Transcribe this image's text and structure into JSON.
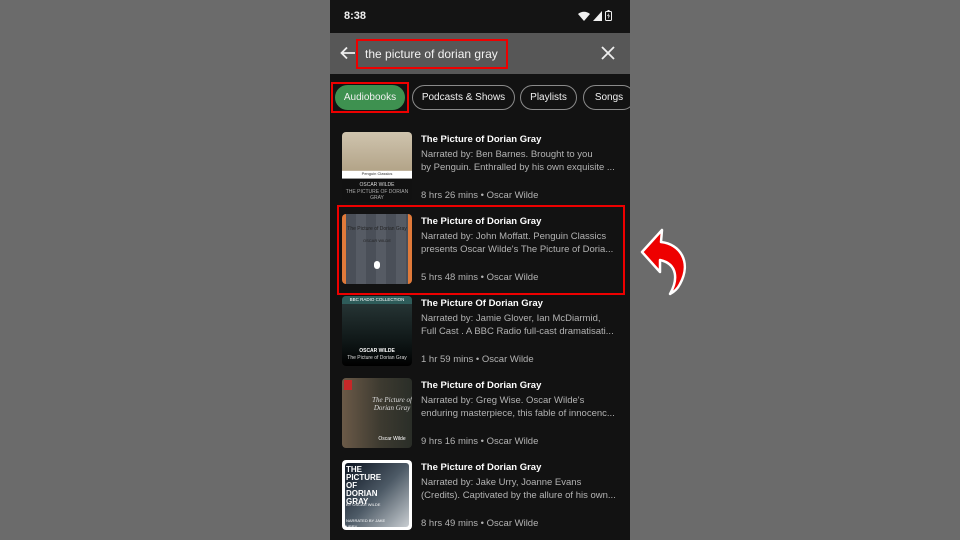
{
  "status_bar": {
    "time": "8:38",
    "icons": [
      "wifi-icon",
      "cell-signal-icon",
      "battery-charging-icon"
    ]
  },
  "search": {
    "back_icon": "arrow-left-icon",
    "query": "the picture of dorian gray",
    "clear_icon": "close-icon"
  },
  "filters": {
    "chips": [
      {
        "label": "Audiobooks",
        "active": true
      },
      {
        "label": "Podcasts & Shows",
        "active": false
      },
      {
        "label": "Playlists",
        "active": false
      },
      {
        "label": "Songs",
        "active": false
      }
    ]
  },
  "results": [
    {
      "title": "The Picture of Dorian Gray",
      "desc_line1": "Narrated by: Ben Barnes. Brought to you",
      "desc_line2": "by Penguin. Enthralled by his own exquisite ...",
      "duration": "8 hrs 26 mins",
      "author": "Oscar Wilde",
      "cover": {
        "top": "Penguin Classics",
        "author": "OSCAR WILDE",
        "title": "THE PICTURE OF DORIAN GRAY"
      }
    },
    {
      "title": "The Picture of Dorian Gray",
      "desc_line1": "Narrated by: John Moffatt. Penguin Classics",
      "desc_line2": "presents Oscar Wilde's The Picture of Doria...",
      "duration": "5 hrs 48 mins",
      "author": "Oscar Wilde",
      "highlighted": true,
      "cover": {
        "title": "The Picture of Dorian Gray",
        "author": "OSCAR WILDE"
      }
    },
    {
      "title": "The Picture Of Dorian Gray",
      "desc_line1": "Narrated by: Jamie Glover, Ian McDiarmid,",
      "desc_line2": "Full Cast . A BBC Radio full-cast dramatisati...",
      "duration": "1 hr 59 mins",
      "author": "Oscar Wilde",
      "cover": {
        "top": "BBC RADIO COLLECTION",
        "author": "OSCAR WILDE",
        "title": "The Picture of Dorian Gray"
      }
    },
    {
      "title": "The Picture of Dorian Gray",
      "desc_line1": "Narrated by: Greg Wise. Oscar Wilde's",
      "desc_line2": "enduring masterpiece, this fable of innocenc...",
      "duration": "9 hrs 16 mins",
      "author": "Oscar Wilde",
      "cover": {
        "title": "The Picture of Dorian Gray",
        "author": "Oscar Wilde"
      }
    },
    {
      "title": "The Picture of Dorian Gray",
      "desc_line1": "Narrated by: Jake Urry, Joanne Evans",
      "desc_line2": "(Credits). Captivated by the allure of his own...",
      "duration": "8 hrs 49 mins",
      "author": "Oscar Wilde",
      "cover": {
        "title": "THE PICTURE OF DORIAN GRAY",
        "author": "BY OSCAR WILDE",
        "narrator": "NARRATED BY JAKE URRY"
      }
    }
  ],
  "meta_separator": " • ",
  "annotation": {
    "arrow_icon": "curved-arrow-icon",
    "color": "#ee0000"
  },
  "colors": {
    "accent": "#3e9150",
    "background": "#121212",
    "highlight": "#ee0000"
  }
}
